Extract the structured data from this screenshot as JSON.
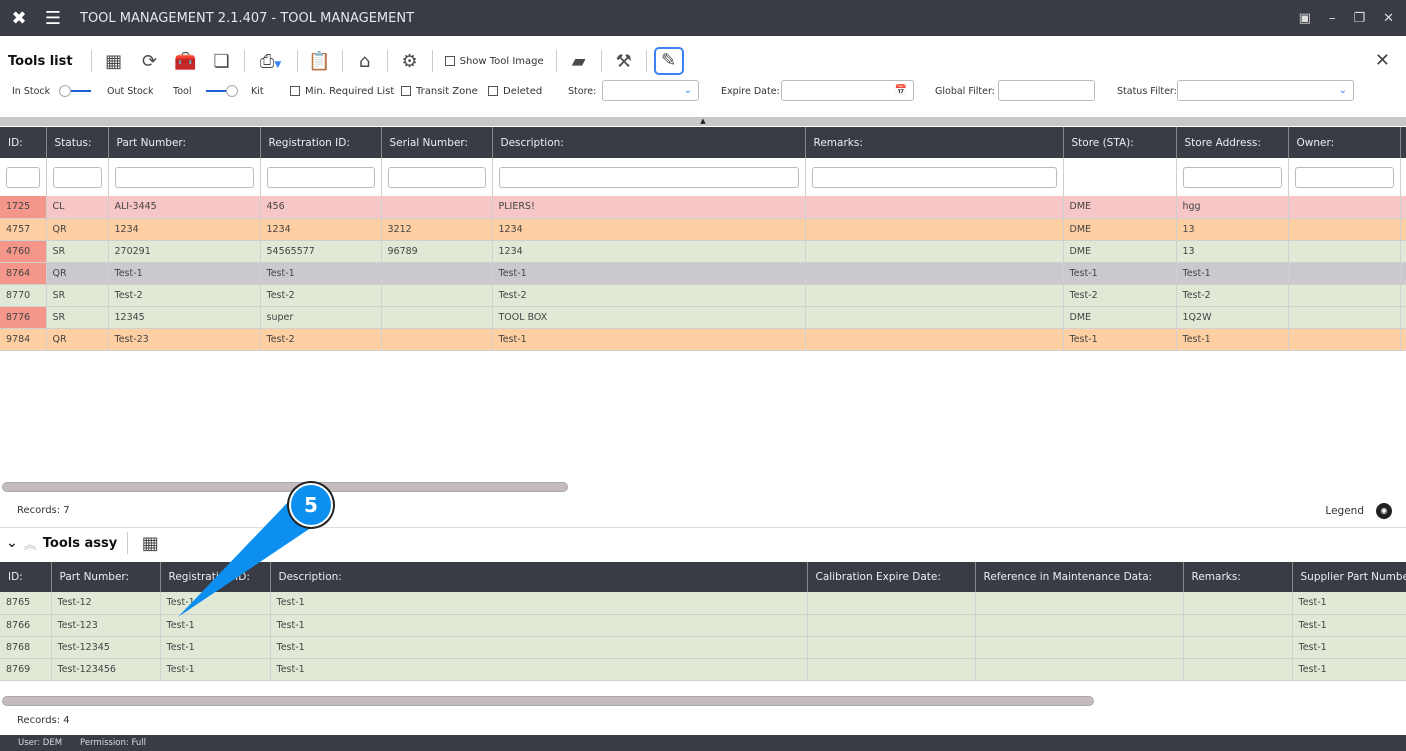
{
  "window": {
    "title": "TOOL MANAGEMENT 2.1.407 - TOOL MANAGEMENT"
  },
  "toolbar": {
    "title": "Tools list",
    "show_tool_image": "Show Tool Image"
  },
  "filters": {
    "in_stock": "In Stock",
    "out_stock": "Out Stock",
    "tool": "Tool",
    "kit": "Kit",
    "min_required": "Min. Required List",
    "transit_zone": "Transit Zone",
    "deleted": "Deleted",
    "store": "Store:",
    "expire_date": "Expire Date:",
    "global_filter": "Global Filter:",
    "status_filter": "Status Filter:"
  },
  "main_table": {
    "columns": [
      "ID:",
      "Status:",
      "Part Number:",
      "Registration ID:",
      "Serial Number:",
      "Description:",
      "Remarks:",
      "Store (STA):",
      "Store Address:",
      "Owner:"
    ],
    "rows": [
      {
        "id": "1725",
        "status": "CL",
        "part": "ALI-3445",
        "reg": "456",
        "serial": "",
        "desc": "PLIERS!",
        "remarks": "",
        "store": "DME",
        "addr": "hgg",
        "owner": "",
        "color": "pink",
        "id_flag": true
      },
      {
        "id": "4757",
        "status": "QR",
        "part": "1234",
        "reg": "1234",
        "serial": "3212",
        "desc": "1234",
        "remarks": "",
        "store": "DME",
        "addr": "13",
        "owner": "",
        "color": "orange",
        "id_flag": false
      },
      {
        "id": "4760",
        "status": "SR",
        "part": "270291",
        "reg": "54565577",
        "serial": "96789",
        "desc": "1234",
        "remarks": "",
        "store": "DME",
        "addr": "13",
        "owner": "",
        "color": "green",
        "id_flag": true
      },
      {
        "id": "8764",
        "status": "QR",
        "part": "Test-1",
        "reg": "Test-1",
        "serial": "",
        "desc": "Test-1",
        "remarks": "",
        "store": "Test-1",
        "addr": "Test-1",
        "owner": "",
        "color": "gray",
        "id_flag": true
      },
      {
        "id": "8770",
        "status": "SR",
        "part": "Test-2",
        "reg": "Test-2",
        "serial": "",
        "desc": "Test-2",
        "remarks": "",
        "store": "Test-2",
        "addr": "Test-2",
        "owner": "",
        "color": "green",
        "id_flag": false
      },
      {
        "id": "8776",
        "status": "SR",
        "part": "12345",
        "reg": "super",
        "serial": "",
        "desc": "TOOL BOX",
        "remarks": "",
        "store": "DME",
        "addr": "1Q2W",
        "owner": "",
        "color": "green",
        "id_flag": true
      },
      {
        "id": "9784",
        "status": "QR",
        "part": "Test-23",
        "reg": "Test-2",
        "serial": "",
        "desc": "Test-1",
        "remarks": "",
        "store": "Test-1",
        "addr": "Test-1",
        "owner": "",
        "color": "orange",
        "id_flag": false
      }
    ],
    "records": "Records: 7"
  },
  "legend": "Legend",
  "assy": {
    "title": "Tools assy",
    "columns": [
      "ID:",
      "Part Number:",
      "Registration ID:",
      "Description:",
      "Calibration Expire Date:",
      "Reference in Maintenance Data:",
      "Remarks:",
      "Supplier Part Number:"
    ],
    "rows": [
      [
        "8765",
        "Test-12",
        "Test-1",
        "Test-1",
        "",
        "",
        "",
        "Test-1"
      ],
      [
        "8766",
        "Test-123",
        "Test-1",
        "Test-1",
        "",
        "",
        "",
        "Test-1"
      ],
      [
        "8768",
        "Test-12345",
        "Test-1",
        "Test-1",
        "",
        "",
        "",
        "Test-1"
      ],
      [
        "8769",
        "Test-123456",
        "Test-1",
        "Test-1",
        "",
        "",
        "",
        "Test-1"
      ]
    ],
    "records": "Records: 4"
  },
  "callout": "5",
  "statusbar": {
    "user": "User: DEM",
    "permission": "Permission: Full"
  },
  "colors": {
    "pink": "#f7c6c6",
    "orange": "#fecfa3",
    "green": "#dfe9d6",
    "gray": "#cbc9ce",
    "id_flag": "#f4978a",
    "callout": "#0d8ff0"
  }
}
